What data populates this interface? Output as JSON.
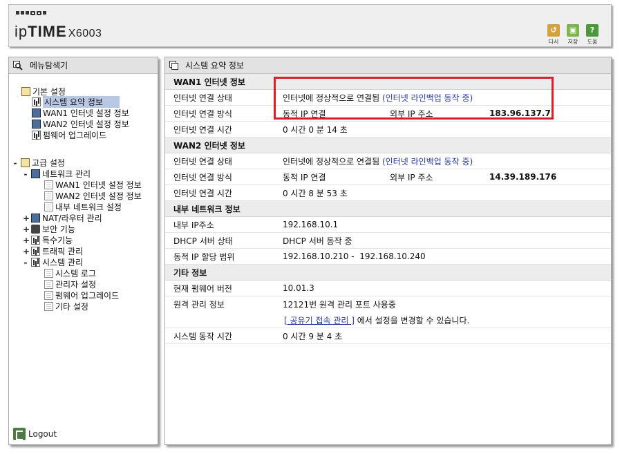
{
  "header": {
    "logo_prefix": "ip",
    "logo_bold": "TIME",
    "model": "X6003",
    "buttons": [
      {
        "label": "다시",
        "icon": "undo-icon",
        "color": "#d4a23a"
      },
      {
        "label": "저장",
        "icon": "save-icon",
        "color": "#7ab648"
      },
      {
        "label": "도움",
        "icon": "help-icon",
        "color": "#4a9a3c"
      }
    ]
  },
  "sidebar": {
    "title": "메뉴탐색기",
    "basic": {
      "label": "기본 설정",
      "items": [
        "시스템 요약 정보",
        "WAN1 인터넷 설정 정보",
        "WAN2 인터넷 설정 정보",
        "펌웨어 업그레이드"
      ]
    },
    "advanced": {
      "label": "고급 설정",
      "network": {
        "label": "네트워크 관리",
        "items": [
          "WAN1 인터넷 설정 정보",
          "WAN2 인터넷 설정 정보",
          "내부 네트워크 설정"
        ]
      },
      "nat": "NAT/라우터 관리",
      "security": "보안 기능",
      "special": "특수기능",
      "traffic": "트래픽 관리",
      "system": {
        "label": "시스템 관리",
        "items": [
          "시스템 로그",
          "관리자 설정",
          "펌웨어 업그레이드",
          "기타 설정"
        ]
      }
    },
    "logout": "Logout"
  },
  "main": {
    "title": "시스템 요약 정보",
    "wan1": {
      "title": "WAN1 인터넷 정보",
      "status_label": "인터넷 연결 상태",
      "status_value": "인터넷에 정상적으로 연결됨",
      "status_extra": "(인터넷 라인백업 동작 중)",
      "method_label": "인터넷 연결 방식",
      "method_value": "동적 IP 연결",
      "ip_label": "외부 IP 주소",
      "ip_value": "183.96.137.7",
      "time_label": "인터넷 연결 시간",
      "time_value": "0 시간 0 분 14 초"
    },
    "wan2": {
      "title": "WAN2 인터넷 정보",
      "status_label": "인터넷 연결 상태",
      "status_value": "인터넷에 정상적으로 연결됨",
      "status_extra": "(인터넷 라인백업 동작 중)",
      "method_label": "인터넷 연결 방식",
      "method_value": "동적 IP 연결",
      "ip_label": "외부 IP 주소",
      "ip_value": "14.39.189.176",
      "time_label": "인터넷 연결 시간",
      "time_value": "0 시간 8 분 53 초"
    },
    "lan": {
      "title": "내부 네트워크 정보",
      "ip_label": "내부 IP주소",
      "ip_value": "192.168.10.1",
      "dhcp_label": "DHCP 서버 상태",
      "dhcp_value": "DHCP 서버 동작 중",
      "range_label": "동적 IP 할당 범위",
      "range_value": "192.168.10.210 -  192.168.10.240"
    },
    "etc": {
      "title": "기타 정보",
      "fw_label": "현재 펌웨어 버전",
      "fw_value": "10.01.3",
      "remote_label": "원격 관리 정보",
      "remote_value": "12121번 원격 관리 포트 사용중",
      "remote_link": "[ 공유기 접속 관리 ]",
      "remote_note": " 에서 설정을 변경할 수 있습니다.",
      "uptime_label": "시스템 동작 시간",
      "uptime_value": "0 시간 9 분 4 초"
    }
  },
  "colors": {
    "highlight_box": "#d6202a",
    "link": "#2a3a9c",
    "selected_menu": "#b8c8e4"
  }
}
